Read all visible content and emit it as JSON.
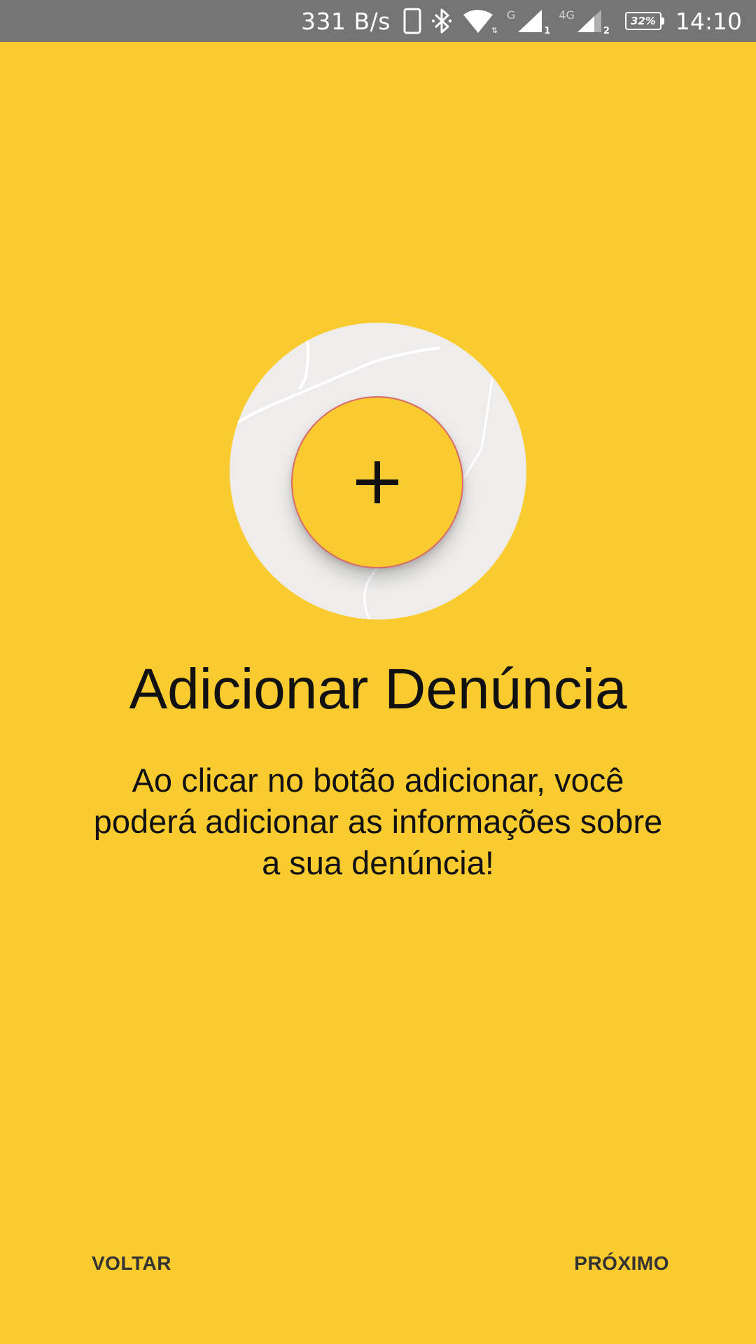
{
  "status_bar": {
    "network_speed": "331 B/s",
    "sim1_label": "G",
    "sim1_index": "1",
    "sim2_label": "4G",
    "sim2_index": "2",
    "battery": "32%",
    "time": "14:10",
    "icons": [
      "phone-icon",
      "bluetooth-icon",
      "wifi-icon",
      "signal-sim1-icon",
      "signal-sim2-icon",
      "battery-icon"
    ]
  },
  "onboarding": {
    "add_icon": "plus-icon",
    "title": "Adicionar Denúncia",
    "description": "Ao clicar no botão adicionar, você poderá adicionar as informações sobre a sua denúncia!"
  },
  "navigation": {
    "back_label": "VOLTAR",
    "next_label": "PRÓXIMO"
  },
  "colors": {
    "background": "#f9cb2f",
    "status_bar": "#757575",
    "map_circle": "#eeedeb",
    "button_border": "#d86a6a"
  }
}
